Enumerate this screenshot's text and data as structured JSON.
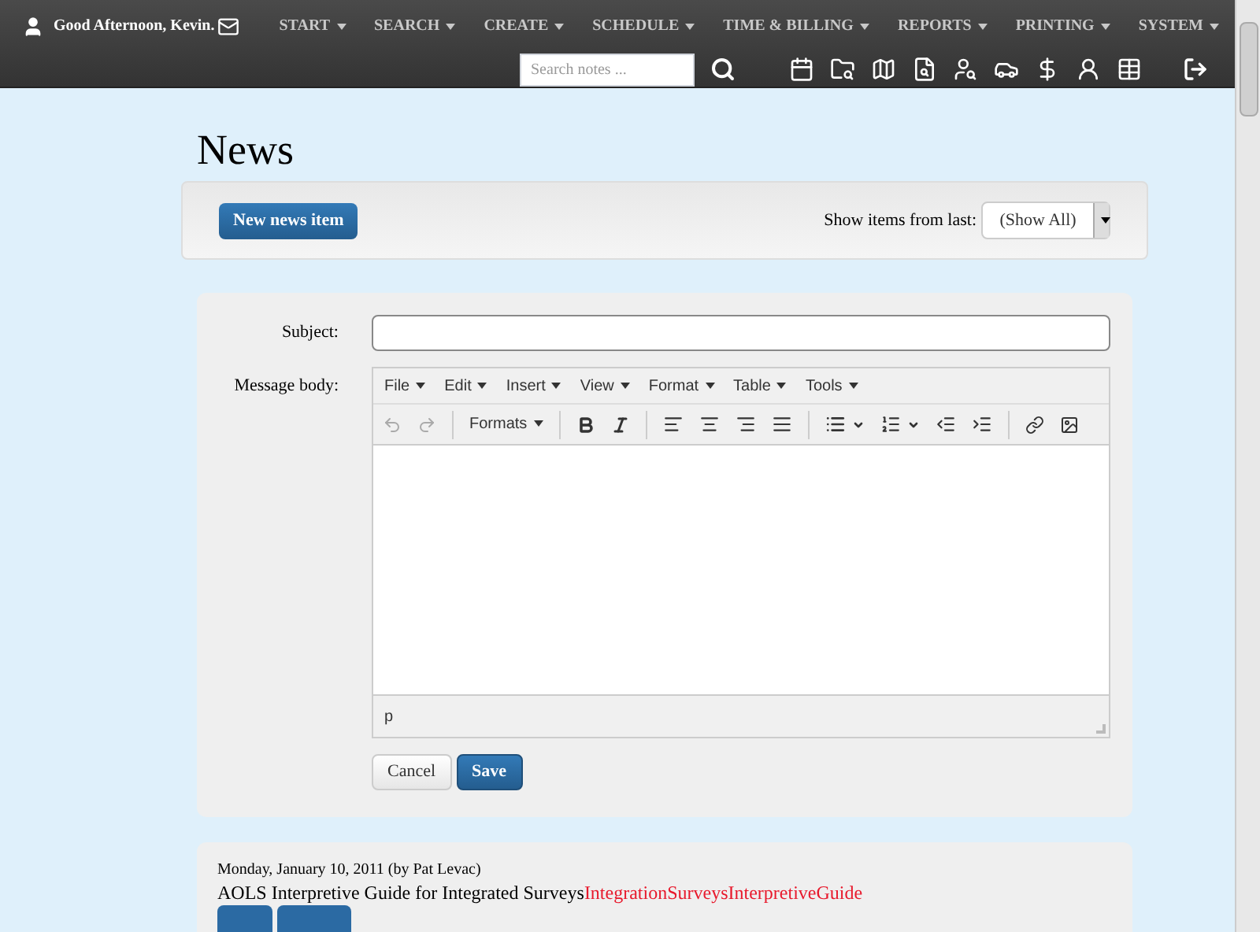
{
  "header": {
    "greeting": "Good Afternoon, Kevin.",
    "menus": [
      "START",
      "SEARCH",
      "CREATE",
      "SCHEDULE",
      "TIME & BILLING",
      "REPORTS",
      "PRINTING",
      "SYSTEM"
    ],
    "search": {
      "placeholder": "Search notes ..."
    }
  },
  "page": {
    "title": "News"
  },
  "actions": {
    "new_button": "New news item",
    "filter_label": "Show items from last:",
    "filter_value": "(Show All)"
  },
  "form": {
    "subject": {
      "label": "Subject:"
    },
    "body": {
      "label": "Message body:"
    },
    "editor": {
      "menus": [
        "File",
        "Edit",
        "Insert",
        "View",
        "Format",
        "Table",
        "Tools"
      ],
      "formats": "Formats",
      "status": "p"
    },
    "buttons": [
      {
        "label": "Cancel",
        "kind": "secondary"
      },
      {
        "label": "Save",
        "kind": "primary"
      }
    ]
  },
  "news": [
    {
      "meta": "Monday, January 10, 2011 (by Pat Levac)",
      "title": "AOLS Interpretive Guide for Integrated Surveys",
      "tags": [
        "Integration",
        "Surveys",
        "InterpretiveGuide"
      ]
    }
  ]
}
